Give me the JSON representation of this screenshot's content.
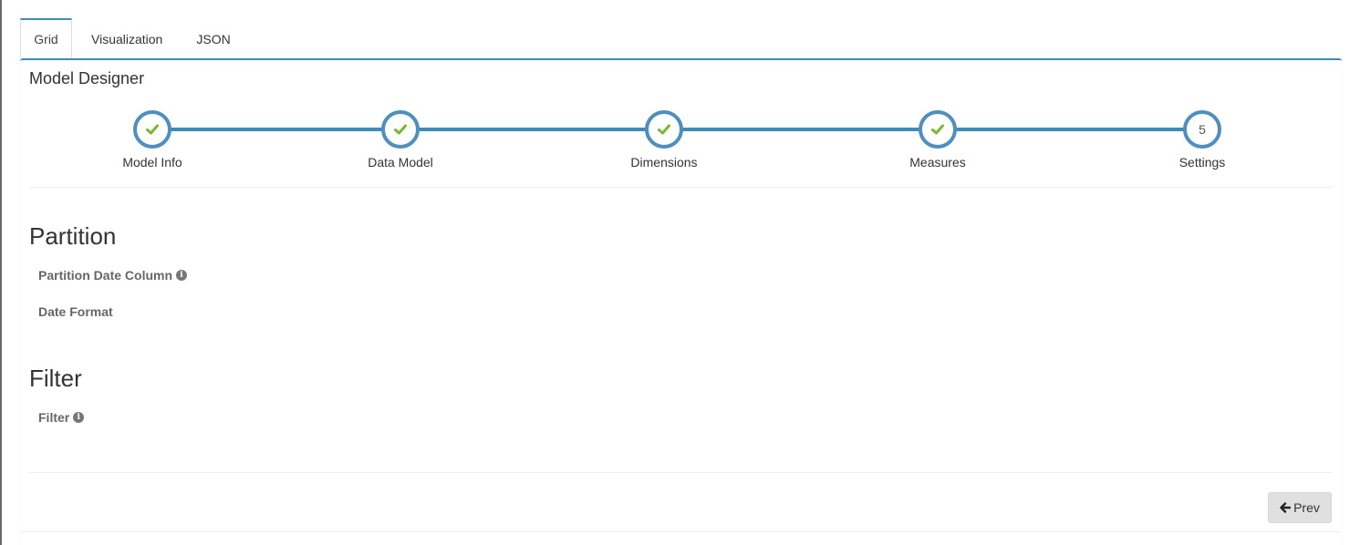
{
  "tabs": [
    {
      "label": "Grid",
      "active": true
    },
    {
      "label": "Visualization",
      "active": false
    },
    {
      "label": "JSON",
      "active": false
    }
  ],
  "panel": {
    "title": "Model Designer"
  },
  "steps": [
    {
      "label": "Model Info",
      "status": "complete",
      "icon": "check-icon"
    },
    {
      "label": "Data Model",
      "status": "complete",
      "icon": "check-icon"
    },
    {
      "label": "Dimensions",
      "status": "complete",
      "icon": "check-icon"
    },
    {
      "label": "Measures",
      "status": "complete",
      "icon": "check-icon"
    },
    {
      "label": "Settings",
      "status": "current",
      "number": "5"
    }
  ],
  "partition": {
    "heading": "Partition",
    "date_column_label": "Partition Date Column",
    "date_format_label": "Date Format"
  },
  "filter": {
    "heading": "Filter",
    "filter_label": "Filter"
  },
  "footer": {
    "prev_label": "Prev"
  },
  "colors": {
    "accent": "#3c8dbc",
    "check": "#7cb82f",
    "button_bg": "#e0e0e0"
  }
}
